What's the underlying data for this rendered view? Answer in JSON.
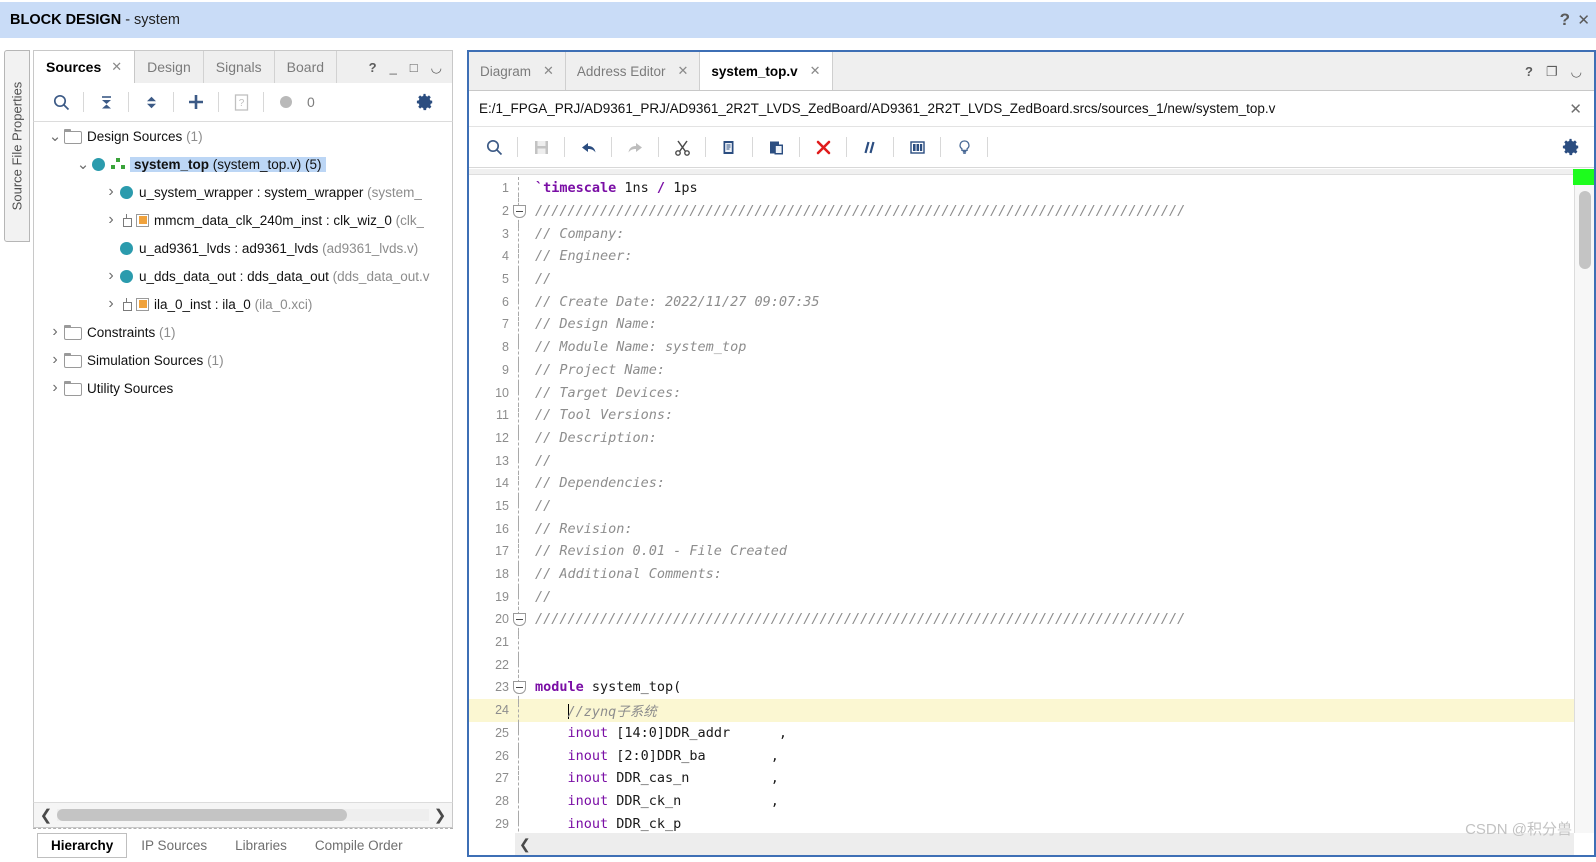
{
  "banner": {
    "title_bold": "BLOCK DESIGN",
    "title_sub": " - system",
    "help_icon": "question-mark-icon",
    "close_icon": "close-icon"
  },
  "left_vertical_tab": {
    "label": "Source File Properties"
  },
  "sources_panel": {
    "tabs": [
      {
        "label": "Sources",
        "active": true,
        "closable": true
      },
      {
        "label": "Design",
        "active": false,
        "closable": false
      },
      {
        "label": "Signals",
        "active": false,
        "closable": false
      },
      {
        "label": "Board",
        "active": false,
        "closable": false
      }
    ],
    "window_buttons": [
      "?",
      "minimize",
      "maximize",
      "float"
    ],
    "toolbar": {
      "search_icon": "search-icon",
      "collapse_all_icon": "collapse-all-icon",
      "expand_all_icon": "expand-all-icon",
      "add_sources_icon": "plus-icon",
      "report_icon": "report-icon",
      "status_count": "0",
      "settings_icon": "gear-icon"
    },
    "tree": [
      {
        "indent": 0,
        "twisty": "down",
        "icon": "folder",
        "name": "Design Sources",
        "suffix": " (1)",
        "selected": false
      },
      {
        "indent": 1,
        "twisty": "down",
        "icon": "module-hier",
        "name": "system_top",
        "suffix": " (system_top.v) (5)",
        "selected": true
      },
      {
        "indent": 2,
        "twisty": "right",
        "icon": "module",
        "name": "u_system_wrapper : system_wrapper",
        "suffix": " (system_",
        "selected": false
      },
      {
        "indent": 2,
        "twisty": "right",
        "icon": "ip",
        "name": "mmcm_data_clk_240m_inst : clk_wiz_0",
        "suffix": " (clk_",
        "selected": false
      },
      {
        "indent": 2,
        "twisty": "none",
        "icon": "module",
        "name": "u_ad9361_lvds : ad9361_lvds",
        "suffix": " (ad9361_lvds.v)",
        "selected": false
      },
      {
        "indent": 2,
        "twisty": "right",
        "icon": "module",
        "name": "u_dds_data_out : dds_data_out",
        "suffix": " (dds_data_out.v",
        "selected": false
      },
      {
        "indent": 2,
        "twisty": "right",
        "icon": "ip",
        "name": "ila_0_inst : ila_0",
        "suffix": " (ila_0.xci)",
        "selected": false
      },
      {
        "indent": 0,
        "twisty": "right",
        "icon": "folder",
        "name": "Constraints",
        "suffix": " (1)",
        "selected": false
      },
      {
        "indent": 0,
        "twisty": "right",
        "icon": "folder",
        "name": "Simulation Sources",
        "suffix": " (1)",
        "selected": false
      },
      {
        "indent": 0,
        "twisty": "right",
        "icon": "folder",
        "name": "Utility Sources",
        "suffix": "",
        "selected": false
      }
    ],
    "bottom_tabs": [
      {
        "label": "Hierarchy",
        "active": true
      },
      {
        "label": "IP Sources",
        "active": false
      },
      {
        "label": "Libraries",
        "active": false
      },
      {
        "label": "Compile Order",
        "active": false
      }
    ],
    "hscroll": {
      "left_arrow": "❮",
      "right_arrow": "❯"
    }
  },
  "editor": {
    "tabs": [
      {
        "label": "Diagram",
        "active": false
      },
      {
        "label": "Address Editor",
        "active": false
      },
      {
        "label": "system_top.v",
        "active": true
      }
    ],
    "window_buttons": [
      "?",
      "restore",
      "float"
    ],
    "file_path": "E:/1_FPGA_PRJ/AD9361_PRJ/AD9361_2R2T_LVDS_ZedBoard/AD9361_2R2T_LVDS_ZedBoard.srcs/sources_1/new/system_top.v",
    "path_close_icon": "close-icon",
    "toolbar_icons": [
      "search-icon",
      "save-icon",
      "undo-icon",
      "redo-icon",
      "cut-icon",
      "copy-icon",
      "paste-icon",
      "delete-icon",
      "comment-icon",
      "columns-icon",
      "lightbulb-icon"
    ],
    "settings_icon": "gear-icon",
    "scroll_marker_color": "#1dfc1d",
    "code_lines": [
      {
        "n": 1,
        "fold": false,
        "hl": false,
        "tokens": [
          {
            "t": "`timescale ",
            "c": "kw"
          },
          {
            "t": "1ns ",
            "c": "num"
          },
          {
            "t": "/",
            "c": "op"
          },
          {
            "t": " 1ps",
            "c": "num"
          }
        ]
      },
      {
        "n": 2,
        "fold": true,
        "hl": false,
        "tokens": [
          {
            "t": "////////////////////////////////////////////////////////////////////////////////",
            "c": "cm"
          }
        ]
      },
      {
        "n": 3,
        "fold": false,
        "hl": false,
        "tokens": [
          {
            "t": "// Company: ",
            "c": "cm"
          }
        ]
      },
      {
        "n": 4,
        "fold": false,
        "hl": false,
        "tokens": [
          {
            "t": "// Engineer: ",
            "c": "cm"
          }
        ]
      },
      {
        "n": 5,
        "fold": false,
        "hl": false,
        "tokens": [
          {
            "t": "// ",
            "c": "cm"
          }
        ]
      },
      {
        "n": 6,
        "fold": false,
        "hl": false,
        "tokens": [
          {
            "t": "// Create Date: 2022/11/27 09:07:35",
            "c": "cm"
          }
        ]
      },
      {
        "n": 7,
        "fold": false,
        "hl": false,
        "tokens": [
          {
            "t": "// Design Name: ",
            "c": "cm"
          }
        ]
      },
      {
        "n": 8,
        "fold": false,
        "hl": false,
        "tokens": [
          {
            "t": "// Module Name: system_top",
            "c": "cm"
          }
        ]
      },
      {
        "n": 9,
        "fold": false,
        "hl": false,
        "tokens": [
          {
            "t": "// Project Name: ",
            "c": "cm"
          }
        ]
      },
      {
        "n": 10,
        "fold": false,
        "hl": false,
        "tokens": [
          {
            "t": "// Target Devices: ",
            "c": "cm"
          }
        ]
      },
      {
        "n": 11,
        "fold": false,
        "hl": false,
        "tokens": [
          {
            "t": "// Tool Versions: ",
            "c": "cm"
          }
        ]
      },
      {
        "n": 12,
        "fold": false,
        "hl": false,
        "tokens": [
          {
            "t": "// Description: ",
            "c": "cm"
          }
        ]
      },
      {
        "n": 13,
        "fold": false,
        "hl": false,
        "tokens": [
          {
            "t": "// ",
            "c": "cm"
          }
        ]
      },
      {
        "n": 14,
        "fold": false,
        "hl": false,
        "tokens": [
          {
            "t": "// Dependencies: ",
            "c": "cm"
          }
        ]
      },
      {
        "n": 15,
        "fold": false,
        "hl": false,
        "tokens": [
          {
            "t": "// ",
            "c": "cm"
          }
        ]
      },
      {
        "n": 16,
        "fold": false,
        "hl": false,
        "tokens": [
          {
            "t": "// Revision:",
            "c": "cm"
          }
        ]
      },
      {
        "n": 17,
        "fold": false,
        "hl": false,
        "tokens": [
          {
            "t": "// Revision 0.01 - File Created",
            "c": "cm"
          }
        ]
      },
      {
        "n": 18,
        "fold": false,
        "hl": false,
        "tokens": [
          {
            "t": "// Additional Comments:",
            "c": "cm"
          }
        ]
      },
      {
        "n": 19,
        "fold": false,
        "hl": false,
        "tokens": [
          {
            "t": "// ",
            "c": "cm"
          }
        ]
      },
      {
        "n": 20,
        "fold": true,
        "hl": false,
        "tokens": [
          {
            "t": "////////////////////////////////////////////////////////////////////////////////",
            "c": "cm"
          }
        ]
      },
      {
        "n": 21,
        "fold": false,
        "hl": false,
        "tokens": [
          {
            "t": "",
            "c": ""
          }
        ]
      },
      {
        "n": 22,
        "fold": false,
        "hl": false,
        "tokens": [
          {
            "t": "",
            "c": ""
          }
        ]
      },
      {
        "n": 23,
        "fold": true,
        "hl": false,
        "tokens": [
          {
            "t": "module",
            "c": "kw"
          },
          {
            "t": " system_top(",
            "c": "num"
          }
        ]
      },
      {
        "n": 24,
        "fold": false,
        "hl": true,
        "cursor": true,
        "tokens": [
          {
            "t": "    ",
            "c": "num"
          },
          {
            "t": "//zynq子系统",
            "c": "cm"
          }
        ]
      },
      {
        "n": 25,
        "fold": false,
        "hl": false,
        "tokens": [
          {
            "t": "    ",
            "c": "num"
          },
          {
            "t": "inout",
            "c": "kw2"
          },
          {
            "t": " [14:0]DDR_addr      ,",
            "c": "num"
          }
        ]
      },
      {
        "n": 26,
        "fold": false,
        "hl": false,
        "tokens": [
          {
            "t": "    ",
            "c": "num"
          },
          {
            "t": "inout",
            "c": "kw2"
          },
          {
            "t": " [2:0]DDR_ba        ,",
            "c": "num"
          }
        ]
      },
      {
        "n": 27,
        "fold": false,
        "hl": false,
        "tokens": [
          {
            "t": "    ",
            "c": "num"
          },
          {
            "t": "inout",
            "c": "kw2"
          },
          {
            "t": " DDR_cas_n          ,",
            "c": "num"
          }
        ]
      },
      {
        "n": 28,
        "fold": false,
        "hl": false,
        "tokens": [
          {
            "t": "    ",
            "c": "num"
          },
          {
            "t": "inout",
            "c": "kw2"
          },
          {
            "t": " DDR_ck_n           ,",
            "c": "num"
          }
        ]
      },
      {
        "n": 29,
        "fold": false,
        "hl": false,
        "tokens": [
          {
            "t": "    ",
            "c": "num"
          },
          {
            "t": "inout",
            "c": "kw2"
          },
          {
            "t": " DDR_ck_p",
            "c": "num"
          }
        ]
      }
    ],
    "hscroll": {
      "left_arrow": "❮"
    }
  },
  "watermark": "CSDN @积分兽"
}
